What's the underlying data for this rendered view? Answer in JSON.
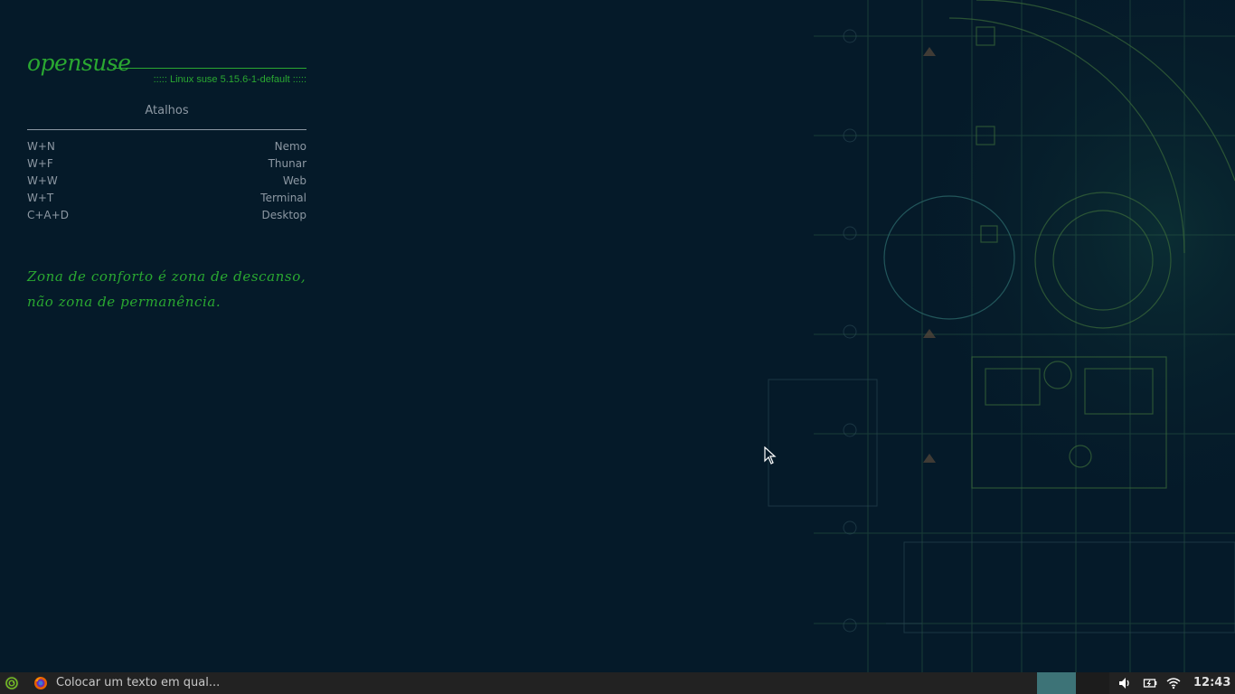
{
  "conky": {
    "logo_text": "opensuse",
    "kernel_line": ":::::   Linux suse 5.15.6-1-default   :::::",
    "section_title": "Atalhos",
    "shortcuts": [
      {
        "keys": "W+N",
        "app": "Nemo"
      },
      {
        "keys": "W+F",
        "app": "Thunar"
      },
      {
        "keys": "W+W",
        "app": "Web"
      },
      {
        "keys": "W+T",
        "app": "Terminal"
      },
      {
        "keys": "C+A+D",
        "app": "Desktop"
      }
    ],
    "quote_line1": "Zona de conforto é zona de descanso,",
    "quote_line2": "não zona de permanência."
  },
  "taskbar": {
    "start_icon": "opensuse-chameleon-icon",
    "browser_icon": "firefox-icon",
    "task_title": "Colocar um texto em qual...",
    "tray_icons": [
      "volume-icon",
      "battery-icon",
      "wifi-icon"
    ],
    "clock": "12:43"
  },
  "colors": {
    "background": "#051a29",
    "accent_green": "#2aa831",
    "text_gray": "#8d98a3",
    "taskbar": "#222222",
    "workspace_active": "#3d7377"
  }
}
